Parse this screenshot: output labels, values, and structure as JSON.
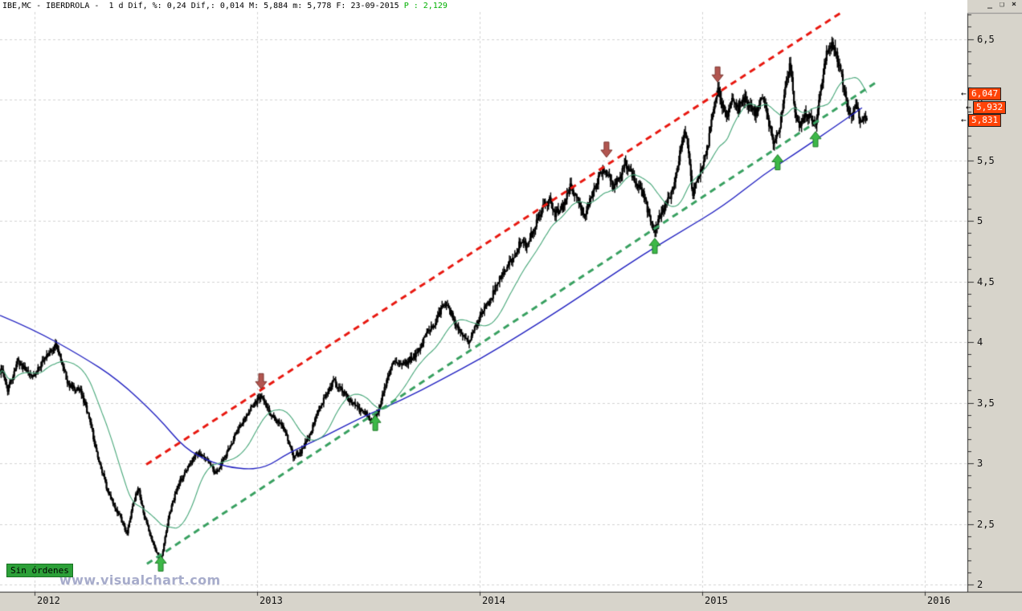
{
  "window": {
    "title_left": "IBE,MC - IBERDROLA -  1 d Dif, %: 0,24 Dif,: 0,014 M: 5,884 m: 5,778 F: 23-09-2015 ",
    "title_p": "P : 2,129",
    "controls": {
      "minimize": "_",
      "restore": "❏",
      "close": "×"
    }
  },
  "status_badge": "Sin órdenes",
  "watermark": "www.visualchart.com",
  "colors": {
    "background": "#ffffff",
    "axis_strip": "#d7d4cb",
    "grid": "#d2d2d2",
    "bars": "#000000",
    "green_ma": "#46a678",
    "blue_ma": "#2020c0",
    "upper_trendline": "#e81810",
    "lower_trendline": "#38a060",
    "buy_arrow": "#3db848",
    "sell_arrow": "#b25650",
    "tag_bg": "#ff4408",
    "p_value_green": "#00b000"
  },
  "price_tags": [
    {
      "name": "price-tag-green-ma",
      "value": "6,047",
      "price": 6.047,
      "indent": 0
    },
    {
      "name": "price-tag-blue-ma",
      "value": "5,932",
      "price": 5.932,
      "indent": 6
    },
    {
      "name": "price-tag-last",
      "value": "5,831",
      "price": 5.831,
      "indent": 0
    }
  ],
  "chart_data": {
    "type": "ohlc-bar",
    "symbol": "IBE,MC",
    "instrument": "IBERDROLA",
    "period": "1 d",
    "dif_pct": "0,24",
    "dif_abs": "0,014",
    "session_max": "5,884",
    "session_min": "5,778",
    "date": "23-09-2015",
    "p_value": "2,129",
    "x_axis": {
      "range": [
        2011.845,
        2016.19
      ],
      "ticks": [
        {
          "t": 2012,
          "label": "2012"
        },
        {
          "t": 2013,
          "label": "2013"
        },
        {
          "t": 2014,
          "label": "2014"
        },
        {
          "t": 2015,
          "label": "2015"
        },
        {
          "t": 2016,
          "label": "2016"
        }
      ]
    },
    "y_axis": {
      "range": [
        1.95,
        6.75
      ],
      "minor_step": 0.1,
      "major_ticks": [
        {
          "p": 6.5,
          "label": "6,5"
        },
        {
          "p": 6.0,
          "label": "6"
        },
        {
          "p": 5.5,
          "label": "5,5"
        },
        {
          "p": 5.0,
          "label": "5"
        },
        {
          "p": 4.5,
          "label": "4,5"
        },
        {
          "p": 4.0,
          "label": "4"
        },
        {
          "p": 3.5,
          "label": "3,5"
        },
        {
          "p": 3.0,
          "label": "3"
        },
        {
          "p": 2.5,
          "label": "2,5"
        },
        {
          "p": 2.0,
          "label": "2"
        }
      ]
    },
    "close_anchors": [
      [
        2011.845,
        3.75
      ],
      [
        2011.852,
        3.78
      ],
      [
        2011.88,
        3.6
      ],
      [
        2011.924,
        3.85
      ],
      [
        2011.989,
        3.7
      ],
      [
        2012.043,
        3.85
      ],
      [
        2012.097,
        3.98
      ],
      [
        2012.152,
        3.65
      ],
      [
        2012.206,
        3.6
      ],
      [
        2012.242,
        3.4
      ],
      [
        2012.285,
        3.05
      ],
      [
        2012.332,
        2.75
      ],
      [
        2012.386,
        2.55
      ],
      [
        2012.415,
        2.42
      ],
      [
        2012.44,
        2.65
      ],
      [
        2012.466,
        2.8
      ],
      [
        2012.495,
        2.55
      ],
      [
        2012.531,
        2.35
      ],
      [
        2012.567,
        2.18
      ],
      [
        2012.603,
        2.55
      ],
      [
        2012.639,
        2.8
      ],
      [
        2012.682,
        2.95
      ],
      [
        2012.729,
        3.08
      ],
      [
        2012.776,
        3.02
      ],
      [
        2012.812,
        2.92
      ],
      [
        2012.856,
        3.05
      ],
      [
        2012.899,
        3.22
      ],
      [
        2012.946,
        3.38
      ],
      [
        2012.993,
        3.5
      ],
      [
        2013.018,
        3.55
      ],
      [
        2013.054,
        3.42
      ],
      [
        2013.09,
        3.35
      ],
      [
        2013.126,
        3.28
      ],
      [
        2013.162,
        3.05
      ],
      [
        2013.199,
        3.1
      ],
      [
        2013.235,
        3.22
      ],
      [
        2013.271,
        3.42
      ],
      [
        2013.307,
        3.55
      ],
      [
        2013.343,
        3.68
      ],
      [
        2013.379,
        3.6
      ],
      [
        2013.415,
        3.52
      ],
      [
        2013.451,
        3.45
      ],
      [
        2013.487,
        3.42
      ],
      [
        2013.513,
        3.35
      ],
      [
        2013.542,
        3.42
      ],
      [
        2013.578,
        3.65
      ],
      [
        2013.614,
        3.85
      ],
      [
        2013.65,
        3.8
      ],
      [
        2013.686,
        3.85
      ],
      [
        2013.722,
        3.92
      ],
      [
        2013.758,
        4.05
      ],
      [
        2013.794,
        4.15
      ],
      [
        2013.83,
        4.28
      ],
      [
        2013.856,
        4.3
      ],
      [
        2013.884,
        4.18
      ],
      [
        2013.921,
        4.05
      ],
      [
        2013.95,
        4.0
      ],
      [
        2013.975,
        4.1
      ],
      [
        2014.0,
        4.2
      ],
      [
        2014.047,
        4.35
      ],
      [
        2014.083,
        4.5
      ],
      [
        2014.119,
        4.6
      ],
      [
        2014.155,
        4.72
      ],
      [
        2014.191,
        4.85
      ],
      [
        2014.209,
        4.8
      ],
      [
        2014.245,
        4.95
      ],
      [
        2014.282,
        5.1
      ],
      [
        2014.318,
        5.18
      ],
      [
        2014.336,
        5.05
      ],
      [
        2014.372,
        5.12
      ],
      [
        2014.408,
        5.28
      ],
      [
        2014.444,
        5.15
      ],
      [
        2014.473,
        5.05
      ],
      [
        2014.509,
        5.25
      ],
      [
        2014.545,
        5.4
      ],
      [
        2014.57,
        5.42
      ],
      [
        2014.596,
        5.28
      ],
      [
        2014.625,
        5.35
      ],
      [
        2014.653,
        5.48
      ],
      [
        2014.679,
        5.4
      ],
      [
        2014.708,
        5.3
      ],
      [
        2014.733,
        5.22
      ],
      [
        2014.762,
        5.05
      ],
      [
        2014.787,
        4.9
      ],
      [
        2014.812,
        5.05
      ],
      [
        2014.841,
        5.15
      ],
      [
        2014.87,
        5.25
      ],
      [
        2014.895,
        5.5
      ],
      [
        2014.921,
        5.75
      ],
      [
        2014.942,
        5.5
      ],
      [
        2014.957,
        5.2
      ],
      [
        2014.978,
        5.35
      ],
      [
        2015.0,
        5.45
      ],
      [
        2015.022,
        5.6
      ],
      [
        2015.051,
        5.9
      ],
      [
        2015.069,
        6.1
      ],
      [
        2015.087,
        5.95
      ],
      [
        2015.112,
        5.85
      ],
      [
        2015.137,
        6.0
      ],
      [
        2015.159,
        5.9
      ],
      [
        2015.184,
        6.02
      ],
      [
        2015.209,
        5.95
      ],
      [
        2015.238,
        5.88
      ],
      [
        2015.267,
        6.05
      ],
      [
        2015.292,
        5.85
      ],
      [
        2015.321,
        5.62
      ],
      [
        2015.347,
        5.75
      ],
      [
        2015.375,
        6.1
      ],
      [
        2015.394,
        6.28
      ],
      [
        2015.419,
        5.9
      ],
      [
        2015.44,
        5.75
      ],
      [
        2015.462,
        5.9
      ],
      [
        2015.484,
        5.85
      ],
      [
        2015.509,
        5.78
      ],
      [
        2015.534,
        6.1
      ],
      [
        2015.556,
        6.35
      ],
      [
        2015.581,
        6.48
      ],
      [
        2015.599,
        6.4
      ],
      [
        2015.625,
        6.22
      ],
      [
        2015.646,
        6.0
      ],
      [
        2015.664,
        5.85
      ],
      [
        2015.682,
        5.95
      ],
      [
        2015.7,
        5.9
      ],
      [
        2015.715,
        5.82
      ],
      [
        2015.733,
        5.88
      ],
      [
        2015.744,
        5.831
      ]
    ],
    "blue_ma_anchors": [
      [
        2011.845,
        4.22
      ],
      [
        2011.989,
        4.11
      ],
      [
        2012.206,
        3.89
      ],
      [
        2012.375,
        3.69
      ],
      [
        2012.556,
        3.38
      ],
      [
        2012.675,
        3.12
      ],
      [
        2012.801,
        3.0
      ],
      [
        2012.928,
        2.95
      ],
      [
        2013.036,
        2.96
      ],
      [
        2013.144,
        3.09
      ],
      [
        2013.314,
        3.23
      ],
      [
        2013.469,
        3.38
      ],
      [
        2013.65,
        3.52
      ],
      [
        2013.83,
        3.69
      ],
      [
        2014.011,
        3.87
      ],
      [
        2014.191,
        4.07
      ],
      [
        2014.372,
        4.28
      ],
      [
        2014.552,
        4.5
      ],
      [
        2014.733,
        4.72
      ],
      [
        2014.913,
        4.92
      ],
      [
        2015.094,
        5.12
      ],
      [
        2015.274,
        5.38
      ],
      [
        2015.455,
        5.6
      ],
      [
        2015.599,
        5.78
      ],
      [
        2015.718,
        5.932
      ]
    ],
    "green_ma_window_bars": 34,
    "trendlines": [
      {
        "name": "upper-channel",
        "color": "#e81810",
        "from": [
          2012.502,
          2.99
        ],
        "to": [
          2015.635,
          6.73
        ]
      },
      {
        "name": "lower-channel",
        "color": "#38a060",
        "from": [
          2012.505,
          2.17
        ],
        "to": [
          2015.78,
          6.14
        ]
      }
    ],
    "signals": [
      {
        "t": 2012.567,
        "price": 2.17,
        "dir": "up"
      },
      {
        "t": 2013.018,
        "price": 3.68,
        "dir": "down"
      },
      {
        "t": 2013.531,
        "price": 3.33,
        "dir": "up"
      },
      {
        "t": 2014.57,
        "price": 5.59,
        "dir": "down"
      },
      {
        "t": 2014.787,
        "price": 4.79,
        "dir": "up"
      },
      {
        "t": 2015.069,
        "price": 6.21,
        "dir": "down"
      },
      {
        "t": 2015.339,
        "price": 5.48,
        "dir": "up"
      },
      {
        "t": 2015.509,
        "price": 5.67,
        "dir": "up"
      }
    ],
    "last_values": {
      "green_ma": "6,047",
      "blue_ma": "5,932",
      "last_price": "5,831"
    }
  }
}
